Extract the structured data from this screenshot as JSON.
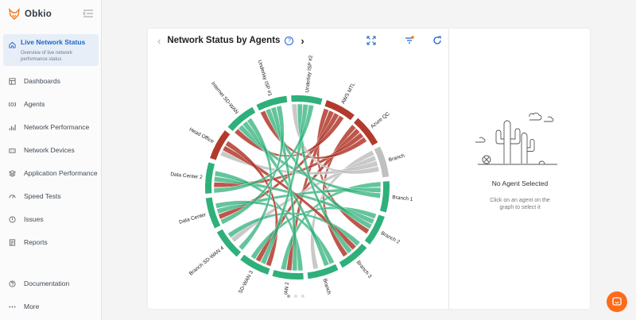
{
  "app": {
    "name": "Obkio",
    "brand_color": "#f47a20",
    "accent": "#1e66c9"
  },
  "sidebar": {
    "active": {
      "label": "Live Network Status",
      "description": "Overview of live network performance status",
      "icon": "home-icon"
    },
    "items": [
      {
        "label": "Dashboards",
        "icon": "dashboard-icon"
      },
      {
        "label": "Agents",
        "icon": "agents-icon"
      },
      {
        "label": "Network Performance",
        "icon": "bar-chart-icon"
      },
      {
        "label": "Network Devices",
        "icon": "device-icon"
      },
      {
        "label": "Application Performance",
        "icon": "layers-icon"
      },
      {
        "label": "Speed Tests",
        "icon": "gauge-icon"
      },
      {
        "label": "Issues",
        "icon": "alert-icon"
      },
      {
        "label": "Reports",
        "icon": "report-icon"
      }
    ],
    "footer": [
      {
        "label": "Documentation",
        "icon": "question-icon"
      },
      {
        "label": "More",
        "icon": "more-icon"
      }
    ]
  },
  "panel": {
    "title": "Network Status by Agents",
    "help": "?",
    "prev": "‹",
    "next": "›"
  },
  "chord": {
    "healthy_color": "#2fb07a",
    "warning_color": "#c0c0c0",
    "critical_color": "#b23a2c",
    "agents": [
      {
        "name": "AWS MTL",
        "status": "critical"
      },
      {
        "name": "Azure QC",
        "status": "critical"
      },
      {
        "name": "Branch",
        "status": "warning"
      },
      {
        "name": "Branch 1",
        "status": "healthy"
      },
      {
        "name": "Branch 2",
        "status": "healthy"
      },
      {
        "name": "Branch 3",
        "status": "healthy"
      },
      {
        "name": "Branch SD-WAN 1",
        "status": "healthy"
      },
      {
        "name": "Branch SD-WAN 2",
        "status": "healthy"
      },
      {
        "name": "Branch SD-WAN 3",
        "status": "healthy"
      },
      {
        "name": "Branch SD-WAN 4",
        "status": "healthy"
      },
      {
        "name": "Data Center",
        "status": "healthy"
      },
      {
        "name": "Data Center 2",
        "status": "healthy"
      },
      {
        "name": "Head Office",
        "status": "critical"
      },
      {
        "name": "Internet SD-WAN",
        "status": "healthy"
      },
      {
        "name": "Underlay ISP #1",
        "status": "healthy"
      },
      {
        "name": "Underlay ISP #2",
        "status": "healthy"
      }
    ]
  },
  "details": {
    "empty_title": "No Agent Selected",
    "empty_hint_line1": "Click on an agent on the",
    "empty_hint_line2": "graph to select it"
  }
}
